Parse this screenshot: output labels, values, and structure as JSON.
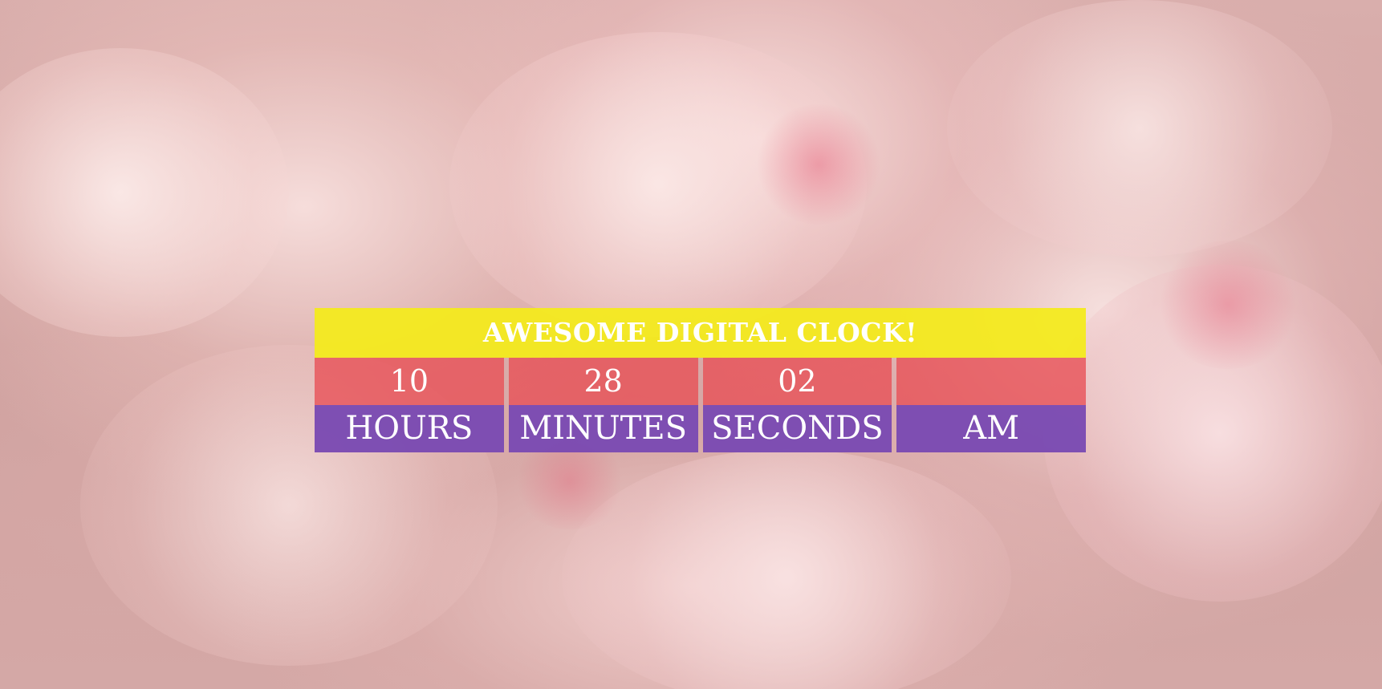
{
  "clock": {
    "title": "AWESOME DIGITAL CLOCK!",
    "hours": {
      "value": "10",
      "label": "HOURS"
    },
    "minutes": {
      "value": "28",
      "label": "MINUTES"
    },
    "seconds": {
      "value": "02",
      "label": "SECONDS"
    },
    "period": {
      "value": "",
      "label": "AM"
    }
  },
  "colors": {
    "title_bg": "#f4ec19",
    "value_bg": "#e84e54",
    "label_bg": "#7a4ab2",
    "text": "#ffffff"
  }
}
